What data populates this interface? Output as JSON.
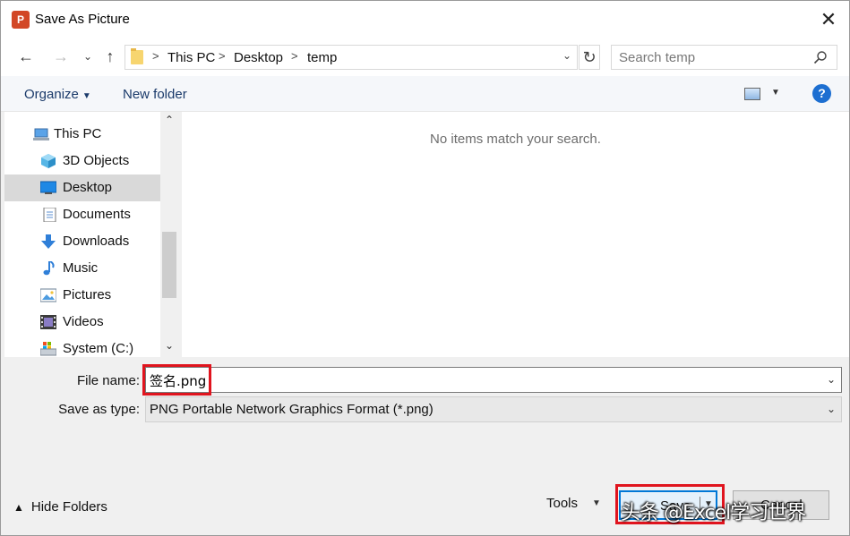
{
  "window": {
    "title": "Save As Picture",
    "app_icon_letter": "P",
    "close_glyph": "✕"
  },
  "nav": {
    "back": "←",
    "forward": "→",
    "recent": "⌄",
    "up": "↑",
    "breadcrumb": [
      "This PC",
      "Desktop",
      "temp"
    ],
    "separator": ">",
    "refresh": "↻",
    "address_dropdown": "⌄"
  },
  "search": {
    "placeholder": "Search temp"
  },
  "toolbar": {
    "organize_label": "Organize",
    "new_folder_label": "New folder",
    "help_label": "?"
  },
  "sidebar": {
    "items": [
      {
        "label": "This PC",
        "icon": "computer-icon"
      },
      {
        "label": "3D Objects",
        "icon": "cube-icon"
      },
      {
        "label": "Desktop",
        "icon": "desktop-icon",
        "selected": true
      },
      {
        "label": "Documents",
        "icon": "document-icon"
      },
      {
        "label": "Downloads",
        "icon": "download-icon"
      },
      {
        "label": "Music",
        "icon": "music-icon"
      },
      {
        "label": "Pictures",
        "icon": "pictures-icon"
      },
      {
        "label": "Videos",
        "icon": "video-icon"
      },
      {
        "label": "System (C:)",
        "icon": "drive-icon"
      }
    ]
  },
  "content": {
    "empty_message": "No items match your search."
  },
  "form": {
    "filename_label": "File name:",
    "filename_value": "签名.png",
    "savetype_label": "Save as type:",
    "savetype_value": "PNG Portable Network Graphics Format (*.png)"
  },
  "footer": {
    "hide_folders_label": "Hide Folders",
    "tools_label": "Tools",
    "save_label": "Save",
    "cancel_label": "Cancel"
  },
  "watermark": "头条 @Excel学习世界",
  "colors": {
    "accent": "#0078d7",
    "highlight": "#e0141e",
    "app_brand": "#d24726",
    "help": "#1d6fd1"
  }
}
